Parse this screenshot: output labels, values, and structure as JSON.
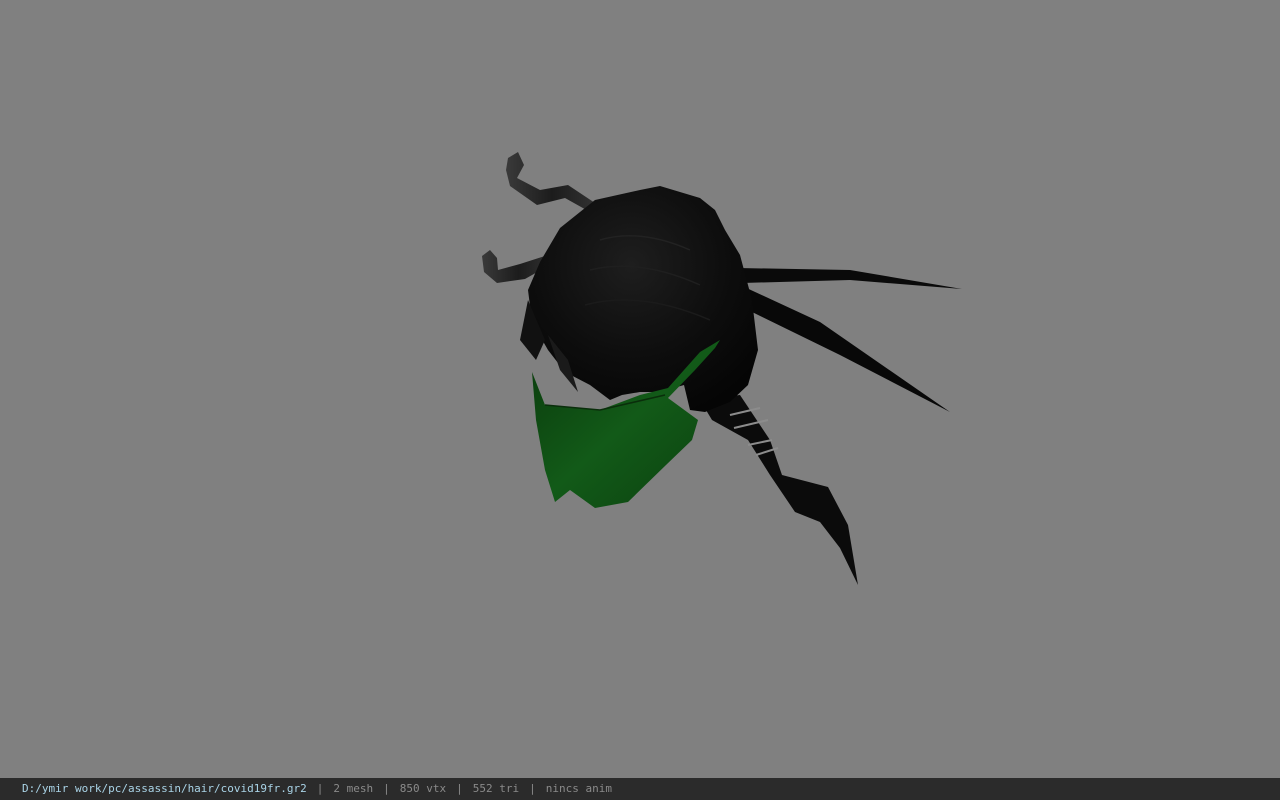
{
  "viewport": {
    "background_color": "#808080",
    "model": {
      "hair_color": "#0c0c0c",
      "mask_color": "#0f4d14",
      "hairpin_color": "#2a2a2a"
    }
  },
  "status_bar": {
    "file_path": "D:/ymir work/pc/assassin/hair/covid19fr.gr2",
    "separator": "|",
    "mesh_count": "2 mesh",
    "vertex_count": "850 vtx",
    "triangle_count": "552 tri",
    "anim_status": "nincs anim"
  }
}
